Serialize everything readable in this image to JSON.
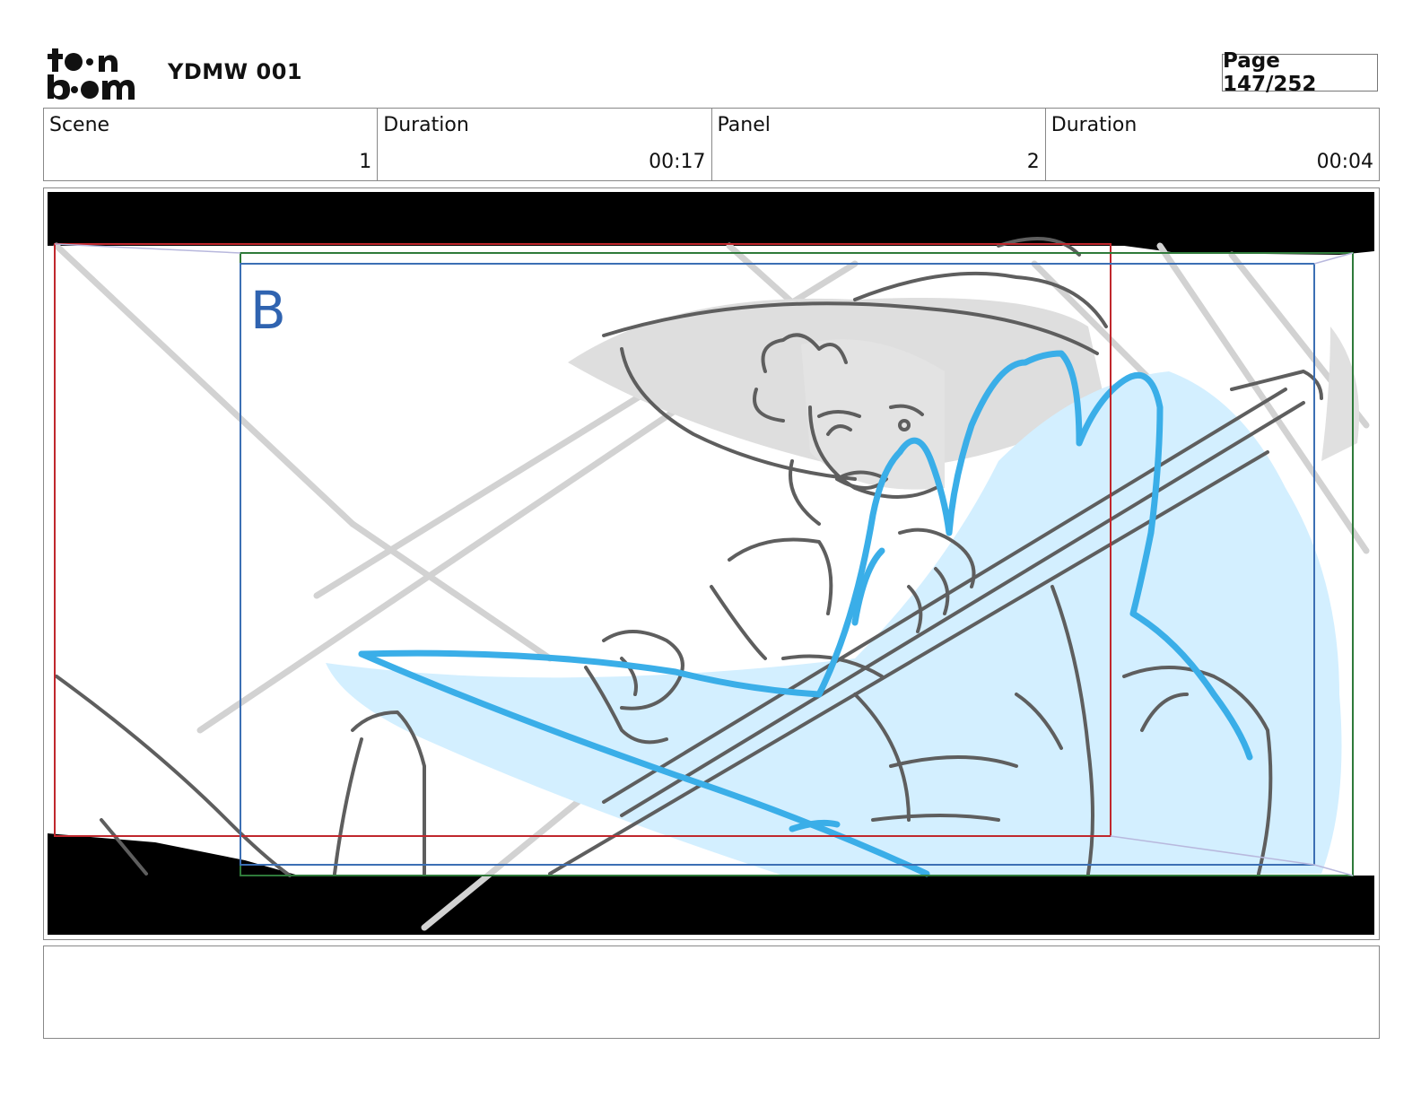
{
  "header": {
    "logo_text": "toon boom",
    "project_title": "YDMW 001",
    "page_label": "Page 147/252"
  },
  "info": [
    {
      "label": "Scene",
      "value": "1"
    },
    {
      "label": "Duration",
      "value": "00:17"
    },
    {
      "label": "Panel",
      "value": "2"
    },
    {
      "label": "Duration",
      "value": "00:04"
    }
  ],
  "panel": {
    "layer_marker": "B",
    "colors": {
      "letterbox": "#000000",
      "sketch_gray": "#5e5e5e",
      "light_gray_fill": "#dcdcdc",
      "effect_blue": "#3aaee8",
      "effect_blue_fill": "#d3efff",
      "frame_red": "#c0272d",
      "frame_green": "#2f7a3a",
      "frame_blue": "#3c6fb4"
    }
  },
  "notes": {
    "text": ""
  }
}
